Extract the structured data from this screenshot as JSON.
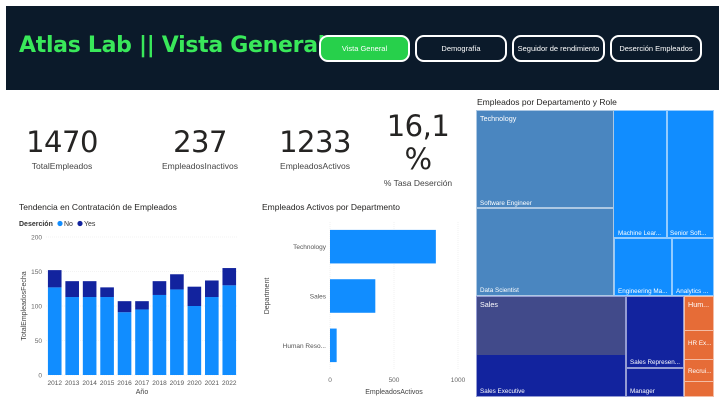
{
  "header": {
    "title": "Atlas Lab || Vista General",
    "nav": [
      {
        "label": "Vista General",
        "active": true
      },
      {
        "label": "Demografía",
        "active": false
      },
      {
        "label": "Seguidor de rendimiento",
        "active": false
      },
      {
        "label": "Deserción Empleados",
        "active": false
      }
    ],
    "colors": {
      "background": "#0b1a2a",
      "title": "#39e85a",
      "active_button": "#27d04b"
    }
  },
  "kpis": [
    {
      "value": "1470",
      "label": "TotalEmpleados"
    },
    {
      "value": "237",
      "label": "EmpleadosInactivos"
    },
    {
      "value": "1233",
      "label": "EmpleadosActivos"
    },
    {
      "value": "16,1 %",
      "value_line1": "16,1",
      "value_line2": "%",
      "label": "% Tasa Deserción"
    }
  ],
  "hiring_chart": {
    "title": "Tendencia en Contratación de Empleados",
    "legend_title": "Deserción",
    "legend": [
      {
        "name": "No",
        "color": "#118dff"
      },
      {
        "name": "Yes",
        "color": "#12239e"
      }
    ],
    "xlabel": "Año",
    "ylabel": "TotalEmpleadosFecha",
    "y_ticks": [
      "0",
      "50",
      "100",
      "150",
      "200"
    ]
  },
  "dept_chart": {
    "title": "Empleados Activos por Departmento",
    "xlabel": "EmpleadosActivos",
    "ylabel": "Department",
    "x_ticks": [
      "0",
      "500",
      "1000"
    ]
  },
  "treemap": {
    "title": "Empleados por Departamento y Role",
    "groups": {
      "technology": "Technology",
      "sales": "Sales",
      "human_resources": "Hum..."
    },
    "cells": {
      "software_engineer": "Software Engineer",
      "data_scientist": "Data Scientist",
      "machine_learning": "Machine Lear...",
      "senior_software": "Senior Soft...",
      "engineering_manager": "Engineering Ma...",
      "analytics": "Analytics ...",
      "sales_executive": "Sales Executive",
      "sales_representative": "Sales Represen...",
      "manager": "Manager",
      "hr_executive": "HR Ex...",
      "recruiter": "Recrui..."
    },
    "colors": {
      "technology": "#118dff",
      "technology_highlight": "#4a86c0",
      "sales": "#12239e",
      "sales_highlight": "#414a8a",
      "hr": "#e66c37"
    }
  },
  "chart_data": [
    {
      "type": "bar",
      "stacked": true,
      "title": "Tendencia en Contratación de Empleados",
      "xlabel": "Año",
      "ylabel": "TotalEmpleadosFecha",
      "categories": [
        "2012",
        "2013",
        "2014",
        "2015",
        "2016",
        "2017",
        "2018",
        "2019",
        "2020",
        "2021",
        "2022"
      ],
      "series": [
        {
          "name": "No",
          "values": [
            127,
            113,
            113,
            113,
            91,
            95,
            116,
            124,
            100,
            113,
            130
          ]
        },
        {
          "name": "Yes",
          "values": [
            25,
            23,
            23,
            14,
            16,
            12,
            20,
            22,
            28,
            24,
            25
          ]
        }
      ],
      "ylim": [
        0,
        200
      ],
      "legend": "top-left"
    },
    {
      "type": "bar",
      "orientation": "horizontal",
      "title": "Empleados Activos por Departmento",
      "xlabel": "EmpleadosActivos",
      "ylabel": "Department",
      "categories": [
        "Technology",
        "Sales",
        "Human Reso..."
      ],
      "values": [
        827,
        354,
        52
      ],
      "xlim": [
        0,
        1000
      ]
    }
  ]
}
